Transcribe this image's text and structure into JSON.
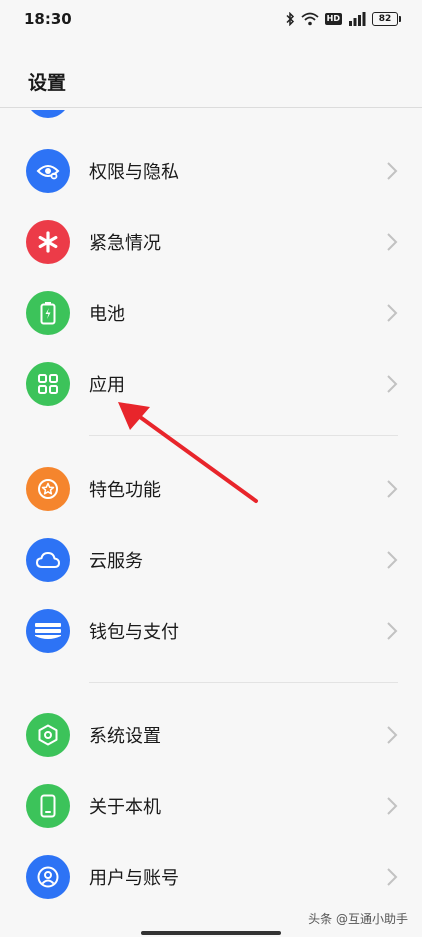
{
  "status": {
    "time": "18:30",
    "hd": "HD",
    "battery": "82"
  },
  "page": {
    "title": "设置"
  },
  "items": [
    {
      "label": "权限与隐私",
      "icon": "privacy-eye-icon",
      "color": "#2d73f5"
    },
    {
      "label": "紧急情况",
      "icon": "emergency-asterisk-icon",
      "color": "#ec3b48"
    },
    {
      "label": "电池",
      "icon": "battery-icon",
      "color": "#3cc35a"
    },
    {
      "label": "应用",
      "icon": "apps-grid-icon",
      "color": "#3cc35a"
    },
    {
      "label": "特色功能",
      "icon": "star-badge-icon",
      "color": "#f5852d"
    },
    {
      "label": "云服务",
      "icon": "cloud-icon",
      "color": "#2d73f5"
    },
    {
      "label": "钱包与支付",
      "icon": "wallet-icon",
      "color": "#2d73f5"
    },
    {
      "label": "系统设置",
      "icon": "system-settings-icon",
      "color": "#3cc35a"
    },
    {
      "label": "关于本机",
      "icon": "phone-icon",
      "color": "#3cc35a"
    },
    {
      "label": "用户与账号",
      "icon": "user-account-icon",
      "color": "#2d73f5"
    }
  ],
  "annotation": {
    "arrow_color": "#e8252b"
  },
  "watermark": {
    "text": "头条 @互通小助手"
  }
}
